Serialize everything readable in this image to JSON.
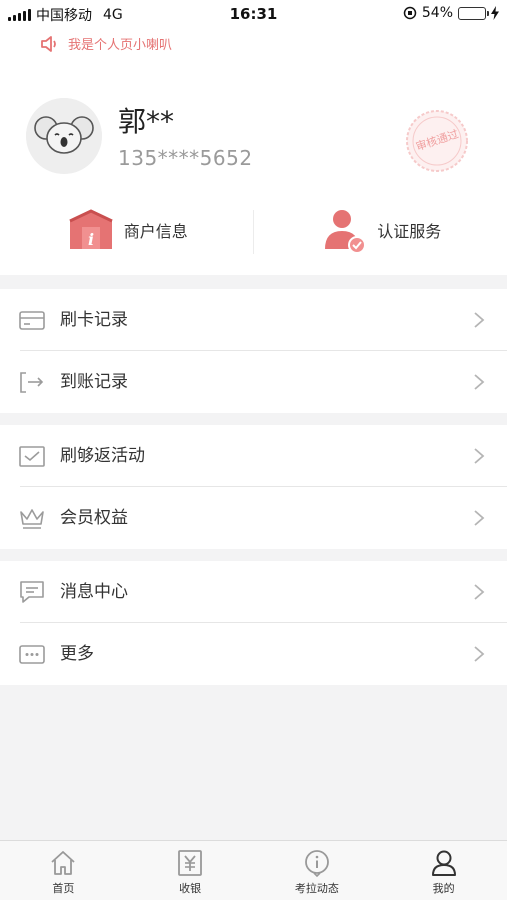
{
  "status_bar": {
    "carrier": "中国移动",
    "network": "4G",
    "time": "16:31",
    "battery_percent": "54%",
    "battery_level": 0.54
  },
  "notice": {
    "text": "我是个人页小喇叭"
  },
  "profile": {
    "name": "郭**",
    "phone": "135****5652",
    "stamp_text": "审核通过"
  },
  "shortcuts": [
    {
      "label": "商户信息",
      "icon": "merchant-info-icon"
    },
    {
      "label": "认证服务",
      "icon": "verification-icon"
    }
  ],
  "menu_groups": [
    [
      {
        "label": "刷卡记录",
        "icon": "card-icon"
      },
      {
        "label": "到账记录",
        "icon": "arrive-icon"
      }
    ],
    [
      {
        "label": "刷够返活动",
        "icon": "check-box-icon"
      },
      {
        "label": "会员权益",
        "icon": "crown-icon"
      }
    ],
    [
      {
        "label": "消息中心",
        "icon": "message-icon"
      },
      {
        "label": "更多",
        "icon": "more-icon"
      }
    ]
  ],
  "tabbar": [
    {
      "label": "首页",
      "icon": "home-icon"
    },
    {
      "label": "收银",
      "icon": "yen-icon"
    },
    {
      "label": "考拉动态",
      "icon": "info-icon"
    },
    {
      "label": "我的",
      "icon": "user-icon"
    }
  ],
  "colors": {
    "accent": "#e57373",
    "background": "#f3f3f4",
    "icon_gray": "#9b9b9b"
  }
}
